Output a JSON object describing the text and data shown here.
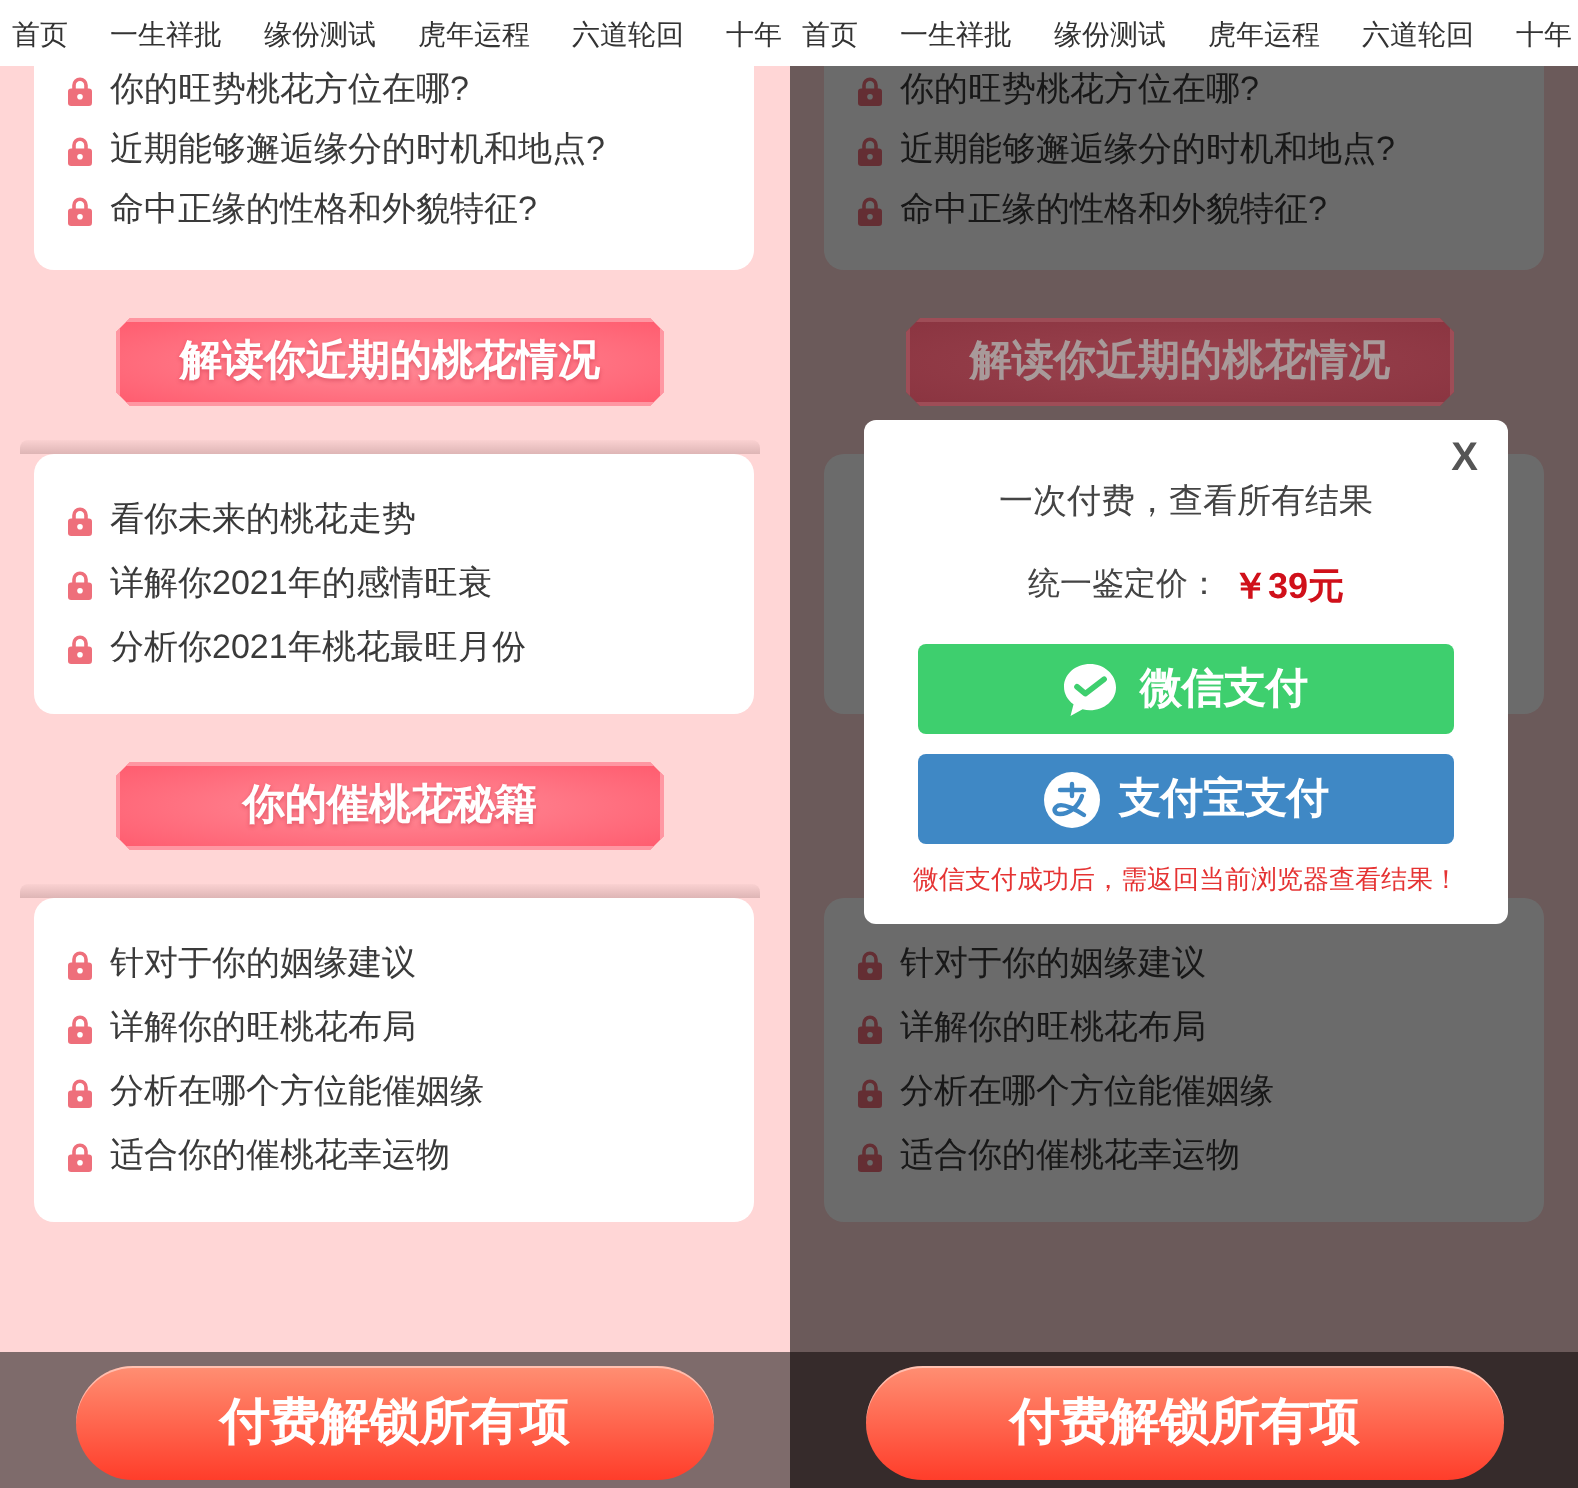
{
  "screens": [
    {
      "nav": [
        "首页",
        "一生祥批",
        "缘份测试",
        "虎年运程",
        "六道轮回",
        "十年"
      ],
      "card_1": {
        "items": [
          "你的旺势桃花方位在哪?",
          "近期能够邂逅缘分的时机和地点?",
          "命中正缘的性格和外貌特征?"
        ]
      },
      "heading_1": "解读你近期的桃花情况",
      "card_2": {
        "items": [
          "看你未来的桃花走势",
          "详解你2021年的感情旺衰",
          "分析你2021年桃花最旺月份"
        ]
      },
      "heading_2": "你的催桃花秘籍",
      "card_3": {
        "items": [
          "针对于你的姻缘建议",
          "详解你的旺桃花布局",
          "分析在哪个方位能催姻缘",
          "适合你的催桃花幸运物"
        ]
      },
      "unlock_button": "付费解锁所有项"
    },
    {
      "nav": [
        "首页",
        "一生祥批",
        "缘份测试",
        "虎年运程",
        "六道轮回",
        "十年"
      ],
      "card_1": {
        "items": [
          "你的旺势桃花方位在哪?",
          "近期能够邂逅缘分的时机和地点?",
          "命中正缘的性格和外貌特征?"
        ]
      },
      "heading_1": "解读你近期的桃花情况",
      "card_3": {
        "items": [
          "针对于你的姻缘建议",
          "详解你的旺桃花布局",
          "分析在哪个方位能催姻缘",
          "适合你的催桃花幸运物"
        ]
      },
      "unlock_button": "付费解锁所有项",
      "dialog": {
        "close": "X",
        "title": "一次付费，查看所有结果",
        "price_label": "统一鉴定价：",
        "price": "￥39元",
        "buttons": [
          {
            "kind": "wechat_pay",
            "label": "微信支付"
          },
          {
            "kind": "alipay",
            "label": "支付宝支付"
          }
        ],
        "note": "微信支付成功后，需返回当前浏览器查看结果！"
      }
    }
  ]
}
